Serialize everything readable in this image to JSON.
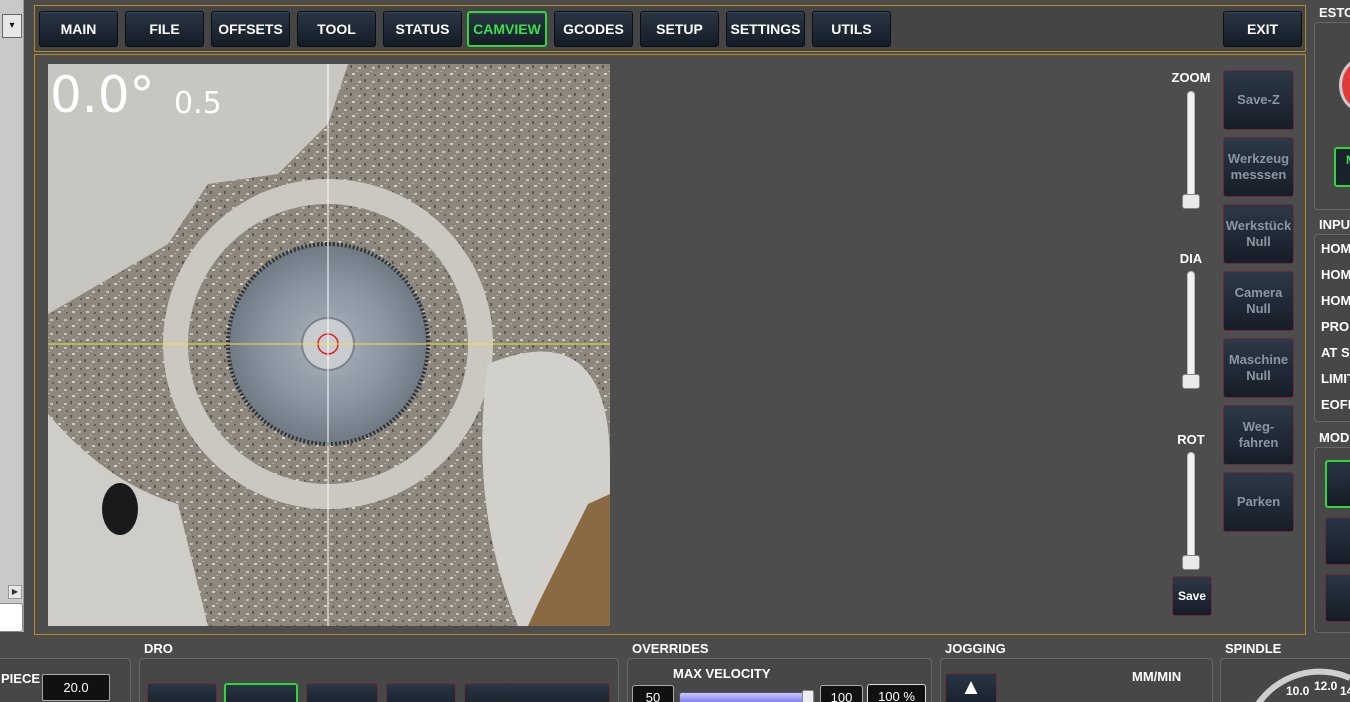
{
  "nav": {
    "tabs": [
      {
        "label": "MAIN"
      },
      {
        "label": "FILE"
      },
      {
        "label": "OFFSETS"
      },
      {
        "label": "TOOL"
      },
      {
        "label": "STATUS"
      },
      {
        "label": "CAMVIEW",
        "active": true
      },
      {
        "label": "GCODES"
      },
      {
        "label": "SETUP"
      },
      {
        "label": "SETTINGS"
      },
      {
        "label": "UTILS"
      }
    ],
    "exit_label": "EXIT"
  },
  "camview": {
    "angle": "0.0°",
    "scale": "0.5",
    "crosshair_color": "#f0e23a",
    "circle_color": "#e11d1d"
  },
  "sliders": {
    "zoom_label": "ZOOM",
    "zoom_level": 0.0,
    "dia_label": "DIA",
    "dia_level": 0.0,
    "rot_label": "ROT",
    "rot_level": 0.0,
    "save_label": "Save"
  },
  "side_buttons": [
    {
      "label": "Save-Z"
    },
    {
      "label": "Werkzeug\nmesssen"
    },
    {
      "label": "Werkstück\nNull"
    },
    {
      "label": "Camera\nNull"
    },
    {
      "label": "Maschine\nNull"
    },
    {
      "label": "Weg-\nfahren"
    },
    {
      "label": "Parken"
    }
  ],
  "right": {
    "estop_title": "ESTO",
    "estop_btn_letter": "M",
    "inputs_title": "INPU",
    "inputs": [
      "HOM",
      "HOM",
      "HOM",
      "PROI",
      "AT SI",
      "LIMIT",
      "EOFF"
    ],
    "mode_title": "MOD"
  },
  "bottom": {
    "piece_label": "PIECE",
    "piece_value": "20.0",
    "dro_title": "DRO",
    "overrides_title": "OVERRIDES",
    "max_velocity_label": "MAX VELOCITY",
    "max_velocity_left": "50",
    "max_velocity_right": "100",
    "max_velocity_percent": "100 %",
    "jogging_title": "JOGGING",
    "jog_units": "MM/MIN",
    "spindle_title": "SPINDLE",
    "spindle_tick_1": "10.0",
    "spindle_tick_2": "12.0",
    "spindle_tick_3": "14"
  },
  "colors": {
    "accent_green": "#39e04a",
    "panel_border": "#b68a20",
    "button_border": "#6d2b3a"
  }
}
